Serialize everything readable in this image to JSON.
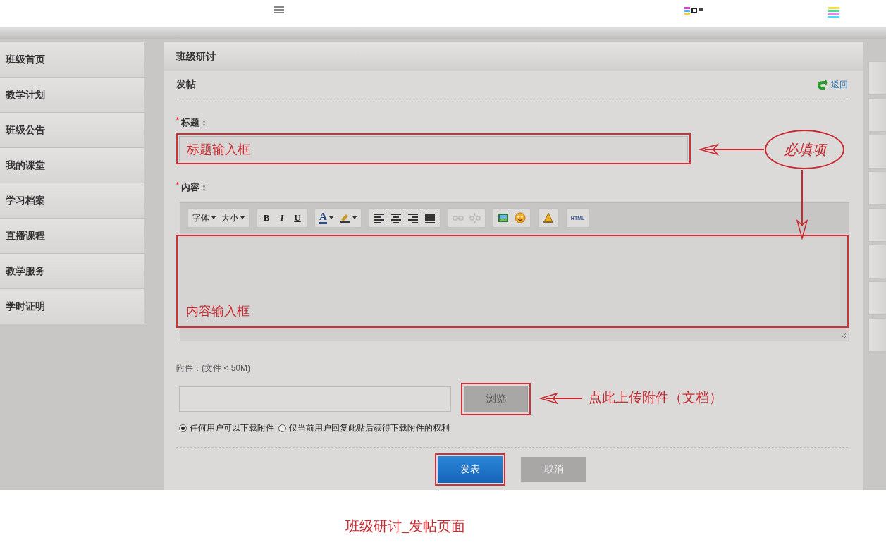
{
  "sidebar": {
    "items": [
      {
        "label": "班级首页",
        "selected": false
      },
      {
        "label": "教学计划",
        "selected": false
      },
      {
        "label": "班级公告",
        "selected": false
      },
      {
        "label": "我的课堂",
        "selected": false
      },
      {
        "label": "学习档案",
        "selected": false
      },
      {
        "label": "直播课程",
        "selected": false
      },
      {
        "label": "教学服务",
        "selected": false
      },
      {
        "label": "学时证明",
        "selected": false
      }
    ]
  },
  "panel": {
    "title": "班级研讨",
    "subtitle": "发帖",
    "back_link": "返回"
  },
  "form": {
    "title_label": {
      "required_mark": "*",
      "text": "标题："
    },
    "title_field": {
      "value": "标题输入框",
      "highlighted": true
    },
    "content_label": {
      "required_mark": "*",
      "text": "内容："
    },
    "toolbar": [
      [
        {
          "kind": "dropdown",
          "label": "字体",
          "disabled": false
        },
        {
          "kind": "dropdown",
          "label": "大小",
          "disabled": false
        }
      ],
      [
        {
          "kind": "bold",
          "label": "B",
          "disabled": false
        },
        {
          "kind": "italic",
          "label": "I",
          "disabled": false
        },
        {
          "kind": "underline",
          "label": "U",
          "disabled": false
        }
      ],
      [
        {
          "kind": "fontcolor",
          "label": "A",
          "disabled": false
        },
        {
          "kind": "highlight",
          "disabled": false
        }
      ],
      [
        {
          "kind": "alignleft",
          "disabled": false
        },
        {
          "kind": "aligncenter",
          "disabled": false
        },
        {
          "kind": "alignright",
          "disabled": false
        },
        {
          "kind": "justify",
          "disabled": false
        }
      ],
      [
        {
          "kind": "link",
          "disabled": true
        },
        {
          "kind": "unlink",
          "disabled": true
        }
      ],
      [
        {
          "kind": "image",
          "disabled": false
        },
        {
          "kind": "emoticon",
          "disabled": false
        }
      ],
      [
        {
          "kind": "flash",
          "disabled": false
        }
      ],
      [
        {
          "kind": "html",
          "label": "HTML",
          "disabled": false
        }
      ]
    ],
    "content_field": {
      "value": "内容输入框",
      "highlighted": true
    },
    "attachment_label": "附件：(文件 < 50M)",
    "browse_button": {
      "label": "浏览",
      "highlighted": true
    },
    "permissions": [
      {
        "label": "任何用户可以下载附件",
        "selected": true
      },
      {
        "label": "仅当前用户回复此贴后获得下载附件的权利",
        "selected": false
      }
    ],
    "actions": [
      {
        "kind": "primary",
        "label": "发表",
        "highlighted": true
      },
      {
        "kind": "secondary",
        "label": "取消",
        "highlighted": false
      }
    ]
  },
  "annotations": {
    "required_callout": "必填项",
    "upload_note": "点此上传附件（文档）",
    "caption": "班级研讨_发帖页面"
  }
}
